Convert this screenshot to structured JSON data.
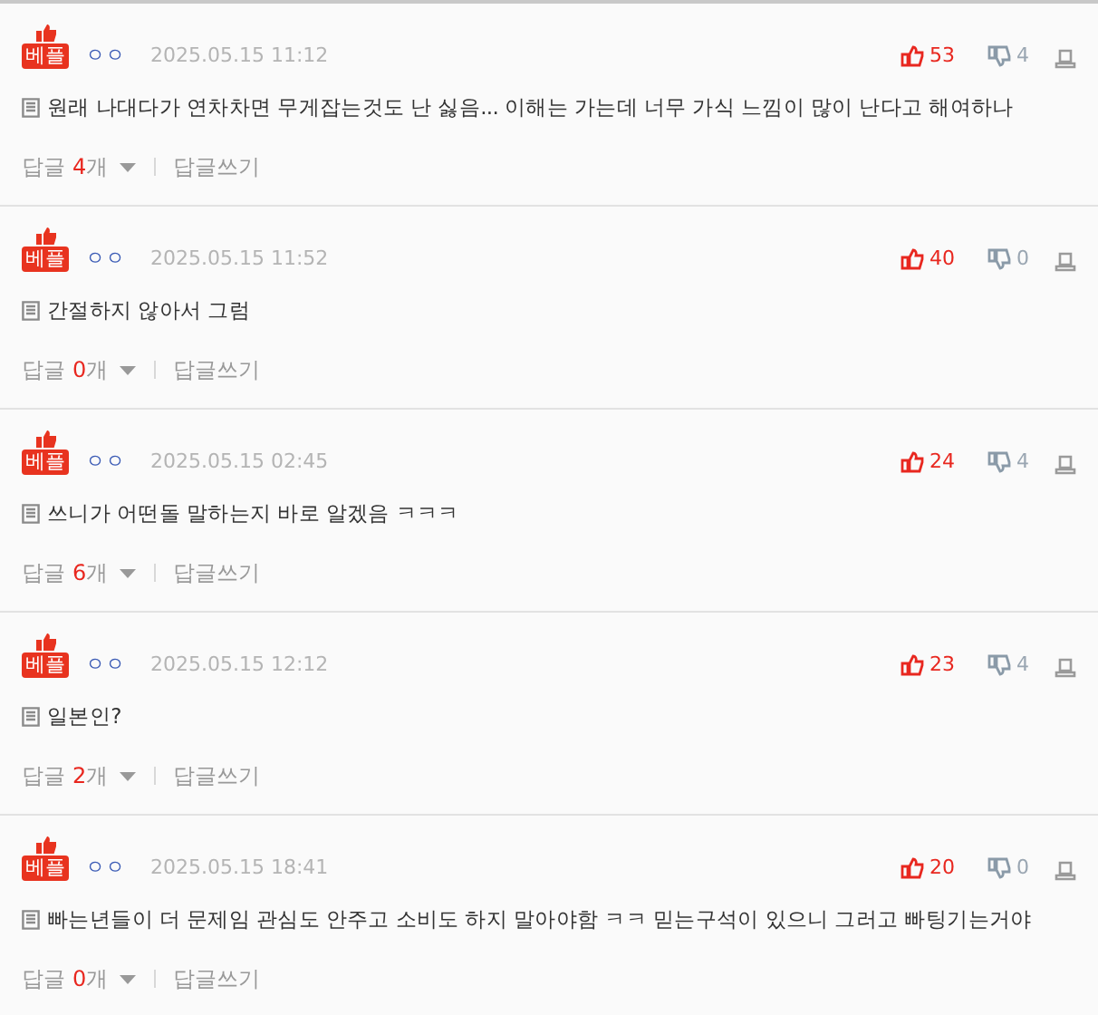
{
  "comments": [
    {
      "badge": "베플",
      "author": "ㅇㅇ",
      "date": "2025.05.15 11:12",
      "likes": "53",
      "dislikes": "4",
      "text": "원래 나대다가 연차차면 무게잡는것도 난 싫음... 이해는 가는데 너무 가식 느낌이 많이 난다고 해여하나",
      "reply_label": "답글",
      "reply_count": "4",
      "reply_unit": "개",
      "write_reply": "답글쓰기"
    },
    {
      "badge": "베플",
      "author": "ㅇㅇ",
      "date": "2025.05.15 11:52",
      "likes": "40",
      "dislikes": "0",
      "text": "간절하지 않아서 그럼",
      "reply_label": "답글",
      "reply_count": "0",
      "reply_unit": "개",
      "write_reply": "답글쓰기"
    },
    {
      "badge": "베플",
      "author": "ㅇㅇ",
      "date": "2025.05.15 02:45",
      "likes": "24",
      "dislikes": "4",
      "text": "쓰니가 어떤돌 말하는지 바로 알겠음 ㅋㅋㅋ",
      "reply_label": "답글",
      "reply_count": "6",
      "reply_unit": "개",
      "write_reply": "답글쓰기"
    },
    {
      "badge": "베플",
      "author": "ㅇㅇ",
      "date": "2025.05.15 12:12",
      "likes": "23",
      "dislikes": "4",
      "text": "일본인?",
      "reply_label": "답글",
      "reply_count": "2",
      "reply_unit": "개",
      "write_reply": "답글쓰기"
    },
    {
      "badge": "베플",
      "author": "ㅇㅇ",
      "date": "2025.05.15 18:41",
      "likes": "20",
      "dislikes": "0",
      "text": "빠는년들이 더 문제임 관심도 안주고 소비도 하지 말아야함 ㅋㅋ 믿는구석이 있으니 그러고 빠팅기는거야",
      "reply_label": "답글",
      "reply_count": "0",
      "reply_unit": "개",
      "write_reply": "답글쓰기"
    }
  ]
}
